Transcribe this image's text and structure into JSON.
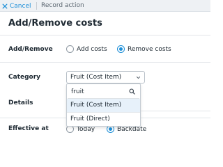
{
  "topbar": {
    "cancel_label": "Cancel",
    "title": "Record action"
  },
  "page": {
    "title": "Add/Remove costs"
  },
  "form": {
    "add_remove": {
      "label": "Add/Remove",
      "options": [
        {
          "label": "Add costs",
          "selected": false
        },
        {
          "label": "Remove costs",
          "selected": true
        }
      ]
    },
    "category": {
      "label": "Category",
      "selected_value": "Fruit (Cost Item)",
      "search_value": "fruit",
      "options": [
        {
          "label": "Fruit (Cost Item)",
          "highlighted": true
        },
        {
          "label": "Fruit (Direct)",
          "highlighted": false
        }
      ]
    },
    "details": {
      "label": "Details"
    },
    "effective_at": {
      "label": "Effective at",
      "options": [
        {
          "label": "Today",
          "selected": false
        },
        {
          "label": "Backdate",
          "selected": true
        }
      ]
    }
  },
  "colors": {
    "accent": "#1d8fd8",
    "highlight": "#e7f1fa",
    "topbar_bg": "#eef1f4"
  },
  "icons": {
    "cancel": "close-icon",
    "dropdown": "chevron-down-icon",
    "search": "search-icon"
  }
}
